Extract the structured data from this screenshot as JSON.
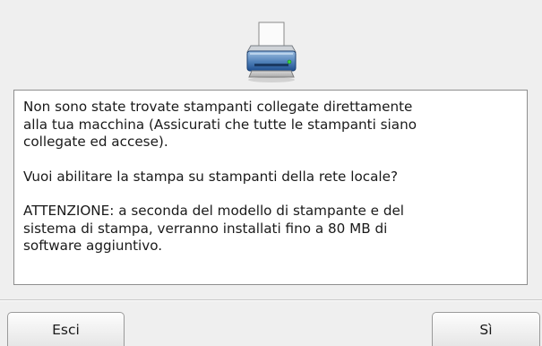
{
  "dialog": {
    "icon": "printer-icon",
    "message": {
      "paragraph1": "Non sono state trovate stampanti collegate direttamente\nalla tua macchina (Assicurati che tutte le stampanti siano\ncollegate ed accese).",
      "paragraph2": "Vuoi abilitare la stampa su stampanti della rete locale?",
      "paragraph3": "ATTENZIONE: a seconda del modello di stampante e del\nsistema di stampa, verranno installati fino a 80 MB di\nsoftware aggiuntivo."
    }
  },
  "buttons": {
    "quit_label": "Esci",
    "yes_label": "Sì"
  }
}
